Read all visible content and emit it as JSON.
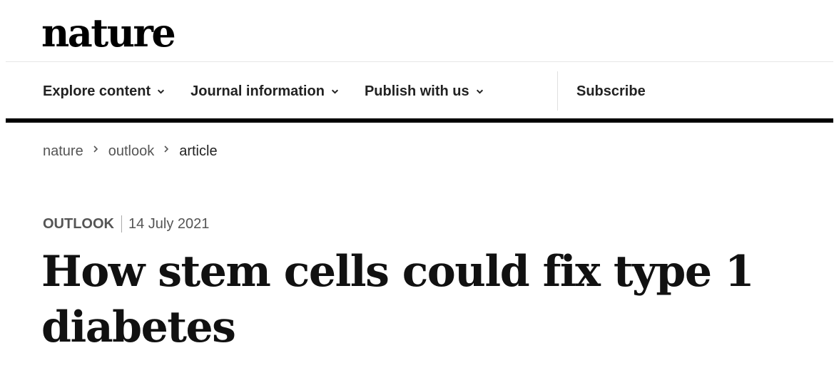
{
  "header": {
    "logo_text": "nature"
  },
  "nav": {
    "items": [
      {
        "label": "Explore content"
      },
      {
        "label": "Journal information"
      },
      {
        "label": "Publish with us"
      }
    ],
    "subscribe_label": "Subscribe"
  },
  "breadcrumb": {
    "items": [
      {
        "label": "nature"
      },
      {
        "label": "outlook"
      },
      {
        "label": "article"
      }
    ]
  },
  "article": {
    "type": "OUTLOOK",
    "date": "14 July 2021",
    "title_line1": "How stem cells could fix type 1",
    "title_line2": "diabetes"
  },
  "icons": {
    "nav_dropdown": "chevron-down-icon",
    "breadcrumb_separator": "chevron-right-icon"
  }
}
